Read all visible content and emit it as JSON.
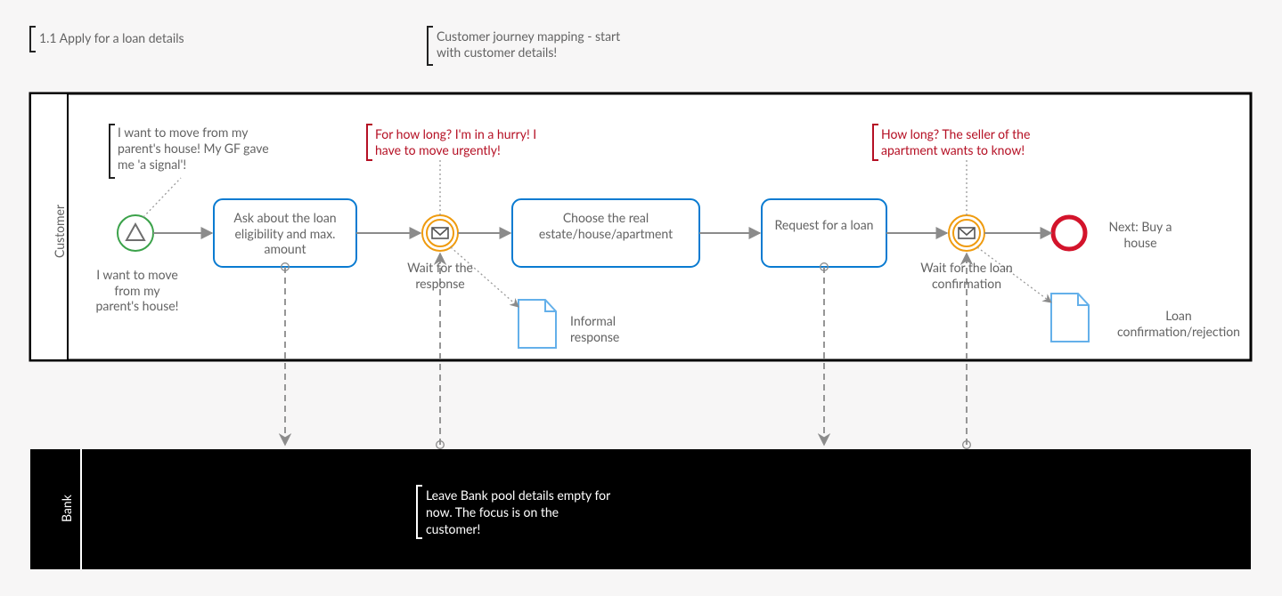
{
  "header": {
    "title": "1.1 Apply for a loan details",
    "note": "Customer journey mapping - start with customer details!"
  },
  "lanes": {
    "customer": "Customer",
    "bank": "Bank"
  },
  "nodes": {
    "start_label": "I want to move from my parent's house!",
    "task1": "Ask about the loan eligibility and max. amount",
    "wait1": "Wait for the response",
    "task2": "Choose the real estate/house/apartment",
    "task3": "Request for a loan",
    "wait2": "Wait for the loan confirmation",
    "end_label": "Next: Buy a house",
    "doc1": "Informal response",
    "doc2": "Loan confirmation/rejection"
  },
  "annotations": {
    "a0": "I want to move from my parent's house! My GF gave me 'a signal'!",
    "a1": "For how long? I'm in a hurry! I have to move urgently!",
    "a2": "How long? The seller of the apartment wants to know!"
  },
  "bank_note": "Leave Bank pool details empty for now. The focus is on the customer!"
}
